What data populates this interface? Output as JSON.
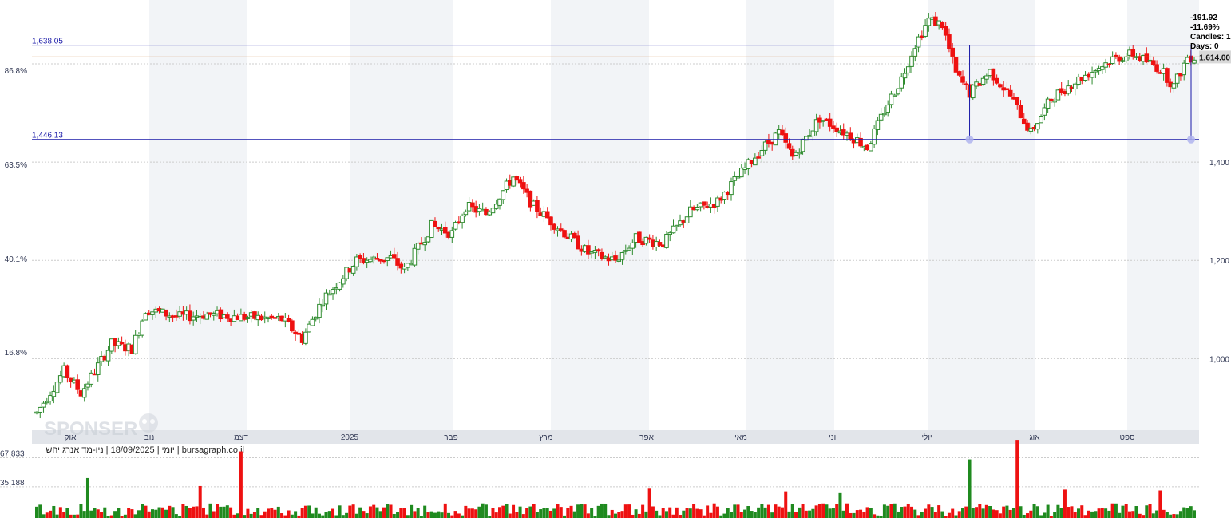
{
  "colors": {
    "up": "#2e8b2e",
    "down": "#ee1111",
    "measure_line": "#1a1aa8",
    "last_line": "#cc7a33",
    "grid": "#cccccc",
    "band": "#f2f4f7",
    "axis_strip": "#e2e5ea",
    "text": "#333a55"
  },
  "caption": "יומי | 18/09/2025 | ניו-מד אנרג יהש | bursagraph.co.il",
  "watermark": "SPONSER",
  "measure": {
    "upper_value": "1,638.05",
    "lower_value": "1,446.13",
    "lines": [
      "-191.92",
      "-11.69%",
      "Candles: 1",
      "Days: 0"
    ]
  },
  "last_price_label": "1,614.00",
  "chart_data": [
    {
      "type": "candlestick",
      "title": "",
      "x_tick_labels": [
        "אוק",
        "נוב",
        "דצמ",
        "2025",
        "פבר",
        "מרץ",
        "אפר",
        "מאי",
        "יוני",
        "יולי",
        "אוג",
        "ספט"
      ],
      "y_ticks_right": [
        "1,000",
        "1,200",
        "1,400"
      ],
      "y_tick_values": [
        1000,
        1200,
        1400
      ],
      "y_ticks_left": [
        "16.8%",
        "40.1%",
        "63.5%",
        "86.8%"
      ],
      "ylim": [
        856,
        1730
      ],
      "grid": true,
      "horizontal_levels": [
        1638.05,
        1446.13,
        1614
      ],
      "anchors": [
        [
          0,
          890
        ],
        [
          8,
          975
        ],
        [
          13,
          930
        ],
        [
          22,
          1030
        ],
        [
          28,
          1020
        ],
        [
          32,
          1100
        ],
        [
          42,
          1085
        ],
        [
          50,
          1090
        ],
        [
          60,
          1085
        ],
        [
          72,
          1080
        ],
        [
          78,
          1040
        ],
        [
          84,
          1120
        ],
        [
          94,
          1200
        ],
        [
          104,
          1205
        ],
        [
          108,
          1180
        ],
        [
          116,
          1270
        ],
        [
          122,
          1255
        ],
        [
          126,
          1310
        ],
        [
          132,
          1295
        ],
        [
          140,
          1370
        ],
        [
          146,
          1310
        ],
        [
          156,
          1250
        ],
        [
          162,
          1215
        ],
        [
          170,
          1200
        ],
        [
          176,
          1245
        ],
        [
          184,
          1235
        ],
        [
          192,
          1300
        ],
        [
          200,
          1320
        ],
        [
          206,
          1370
        ],
        [
          212,
          1420
        ],
        [
          218,
          1460
        ],
        [
          222,
          1410
        ],
        [
          230,
          1490
        ],
        [
          240,
          1450
        ],
        [
          244,
          1430
        ],
        [
          250,
          1520
        ],
        [
          254,
          1570
        ],
        [
          258,
          1640
        ],
        [
          262,
          1690
        ],
        [
          266,
          1680
        ],
        [
          270,
          1580
        ],
        [
          274,
          1540
        ],
        [
          280,
          1585
        ],
        [
          286,
          1535
        ],
        [
          292,
          1460
        ],
        [
          298,
          1530
        ],
        [
          304,
          1560
        ],
        [
          310,
          1585
        ],
        [
          316,
          1610
        ],
        [
          322,
          1620
        ],
        [
          330,
          1590
        ],
        [
          334,
          1555
        ],
        [
          338,
          1614
        ]
      ]
    },
    {
      "type": "bar",
      "title": "volume",
      "y_tick_labels": [
        "67,833",
        "35,188"
      ],
      "y_tick_values": [
        67833,
        35188
      ],
      "ylim": [
        0,
        80000
      ],
      "peaks": [
        [
          15,
          45000
        ],
        [
          48,
          36000
        ],
        [
          60,
          75000
        ],
        [
          180,
          33000
        ],
        [
          220,
          30000
        ],
        [
          236,
          28000
        ],
        [
          274,
          66000
        ],
        [
          288,
          88000
        ],
        [
          302,
          32000
        ],
        [
          330,
          31000
        ]
      ]
    }
  ]
}
